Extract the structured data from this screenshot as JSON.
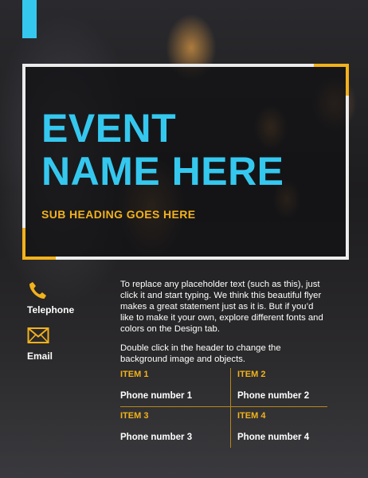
{
  "flyer": {
    "title_line1": "EVENT",
    "title_line2": "NAME HERE",
    "subheading": "SUB HEADING GOES HERE",
    "body_paragraph1": "To replace any placeholder text (such as this), just click it and start typing. We think this beautiful flyer makes a great statement just as it is. But if you’d like to make it your own, explore different fonts and colors on the Design tab.",
    "body_paragraph2": "Double click in the header to change the background image and objects."
  },
  "contacts": [
    {
      "label": "Telephone",
      "icon": "phone-icon"
    },
    {
      "label": "Email",
      "icon": "envelope-icon"
    }
  ],
  "items": [
    {
      "title": "ITEM 1",
      "value": "Phone number 1"
    },
    {
      "title": "ITEM 2",
      "value": "Phone number 2"
    },
    {
      "title": "ITEM 3",
      "value": "Phone number 3"
    },
    {
      "title": "ITEM 4",
      "value": "Phone number 4"
    }
  ],
  "colors": {
    "accent_cyan": "#35c8ef",
    "accent_yellow": "#f2b21c",
    "frame_white": "#ececec"
  }
}
